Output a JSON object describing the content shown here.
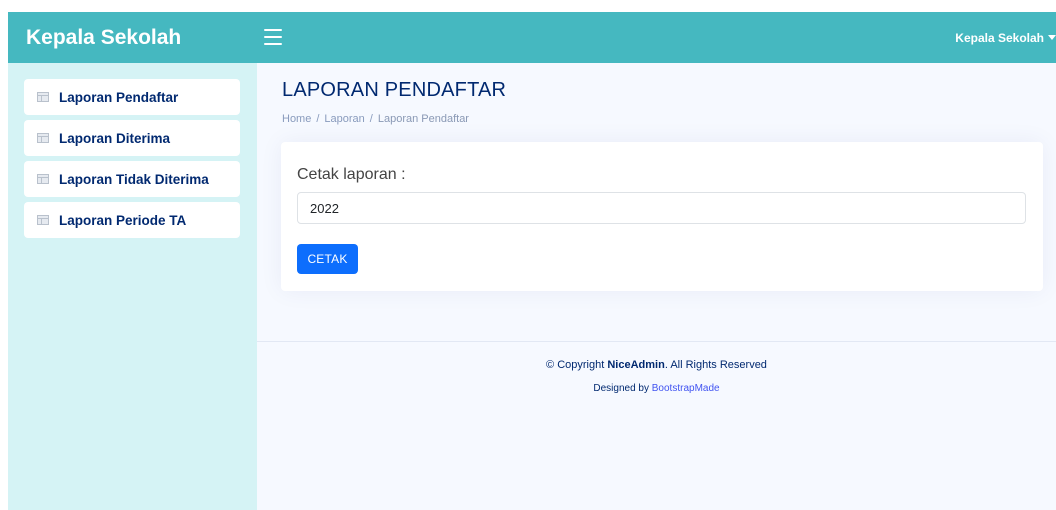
{
  "header": {
    "brand": "Kepala Sekolah",
    "user_label": "Kepala Sekolah"
  },
  "sidebar": {
    "items": [
      {
        "label": "Laporan Pendaftar",
        "icon": "report-icon"
      },
      {
        "label": "Laporan Diterima",
        "icon": "report-icon"
      },
      {
        "label": "Laporan Tidak Diterima",
        "icon": "report-icon"
      },
      {
        "label": "Laporan Periode TA",
        "icon": "report-icon"
      }
    ]
  },
  "main": {
    "title": "LAPORAN PENDAFTAR",
    "breadcrumb": [
      "Home",
      "Laporan",
      "Laporan Pendaftar"
    ],
    "separator": "/",
    "form": {
      "label": "Cetak laporan :",
      "input_value": "2022",
      "button_label": "CETAK"
    }
  },
  "footer": {
    "copyright_prefix": "© Copyright",
    "copyright_brand": "NiceAdmin",
    "copyright_suffix": ". All Rights Reserved",
    "designed_prefix": "Designed by",
    "designed_link": "BootstrapMade"
  },
  "colors": {
    "header_bg": "#45b8c0",
    "sidebar_bg": "#d5f3f5",
    "main_bg": "#f6f9ff",
    "accent": "#0d6efd",
    "title_text": "#012970"
  }
}
